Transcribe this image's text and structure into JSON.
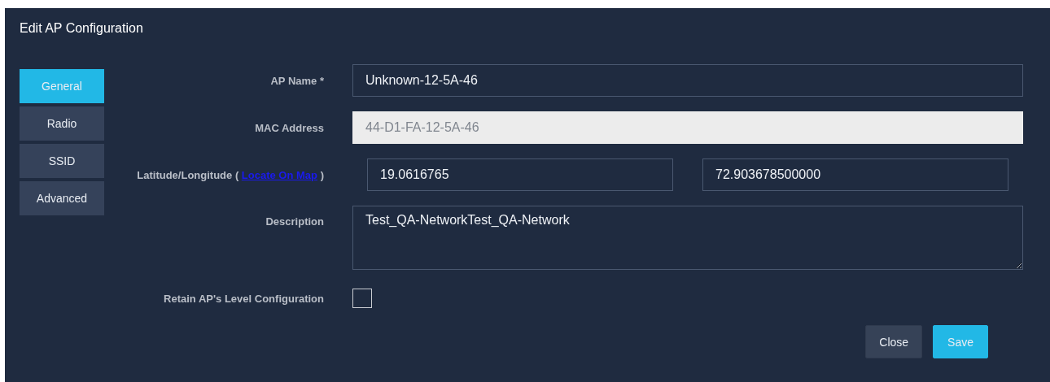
{
  "dialog": {
    "title": "Edit AP Configuration"
  },
  "tabs": [
    {
      "label": "General",
      "selected": true
    },
    {
      "label": "Radio",
      "selected": false
    },
    {
      "label": "SSID",
      "selected": false
    },
    {
      "label": "Advanced",
      "selected": false
    }
  ],
  "fields": {
    "ap_name": {
      "label": "AP Name *",
      "value": "Unknown-12-5A-46"
    },
    "mac_address": {
      "label": "MAC Address",
      "value": "44-D1-FA-12-5A-46",
      "disabled": true
    },
    "location": {
      "label_before": "Latitude/Longitude (",
      "link": "Locate On Map",
      "label_after": ")",
      "latitude": "19.0616765",
      "longitude": "72.903678500000"
    },
    "description": {
      "label": "Description",
      "value": "Test_QA-NetworkTest_QA-Network"
    },
    "retain": {
      "label": "Retain AP's Level Configuration",
      "checked": false
    }
  },
  "buttons": [
    {
      "label": "Close",
      "kind": "secondary"
    },
    {
      "label": "Save",
      "kind": "primary"
    }
  ]
}
